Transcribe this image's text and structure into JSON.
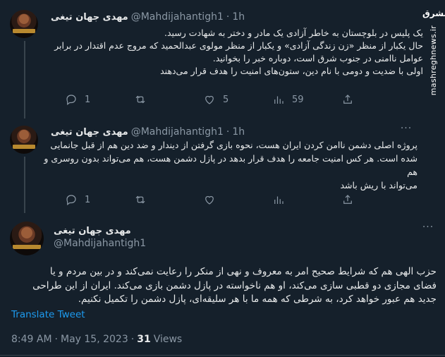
{
  "tweets": [
    {
      "name": "مهدی جهان تیغی",
      "handle": "@Mahdijahantigh1",
      "dot": "·",
      "time": "1h",
      "text_lines": [
        "یک پلیس در بلوچستان به خاطر آزادی یک مادر و دختر به شهادت رسید.",
        "حال یکبار از منظر «زن زندگی آزادی» و یکبار از منظر مولوی عبدالحمید که مروج عدم اقتدار در برابر",
        "عوامل ناامنی در جنوب شرق است، دوباره خبر را بخوانید.",
        "اولی با ضدیت و دومی با نام دین، ستون‌های امنیت را هدف قرار می‌دهند"
      ],
      "replies": "1",
      "retweets": "",
      "likes": "5",
      "views": "59"
    },
    {
      "name": "مهدی جهان تیغی",
      "handle": "@Mahdijahantigh1",
      "dot": "·",
      "time": "1h",
      "text_lines": [
        "پروژه اصلی دشمن ناامن کردن ایران هست، نحوه بازی گرفتن از دیندار و ضد دین هم از قبل جانمایی",
        "شده است. هر کس امنیت جامعه را هدف قرار بدهد در پازل دشمن هست، هم می‌تواند بدون روسری و هم",
        "می‌تواند با ریش باشد"
      ],
      "replies": "1",
      "retweets": "",
      "likes": "",
      "views": ""
    }
  ],
  "main_tweet": {
    "name": "مهدی جهان تیغی",
    "handle": "@Mahdijahantigh1",
    "text_lines": [
      "حزب الهی هم که شرایط صحیح امر به معروف و نهی از منکر را رعایت نمی‌کند و در بین مردم و یا",
      "فضای مجازی دو قطبی سازی می‌کند، او هم ناخواسته در پازل دشمن بازی می‌کند. ایران از این طراحی",
      "جدید هم عبور خواهد کرد، به شرطی که همه ما با هر سلیقه‌ای، پازل دشمن را تکمیل نکنیم."
    ],
    "translate_label": "Translate Tweet",
    "time": "8:49 AM",
    "sep": "·",
    "date": "May 15, 2023",
    "sep2": "·",
    "views_count": "31",
    "views_label": "Views"
  },
  "watermark": {
    "logo_text": "مشرق",
    "url": "mashreghnews.ir"
  },
  "colors": {
    "background": "#15202b",
    "text": "#e7e9ea",
    "muted": "#8b98a5",
    "link": "#1d9bf0"
  },
  "icons": [
    "reply-icon",
    "retweet-icon",
    "like-icon",
    "views-icon",
    "more-icon"
  ]
}
